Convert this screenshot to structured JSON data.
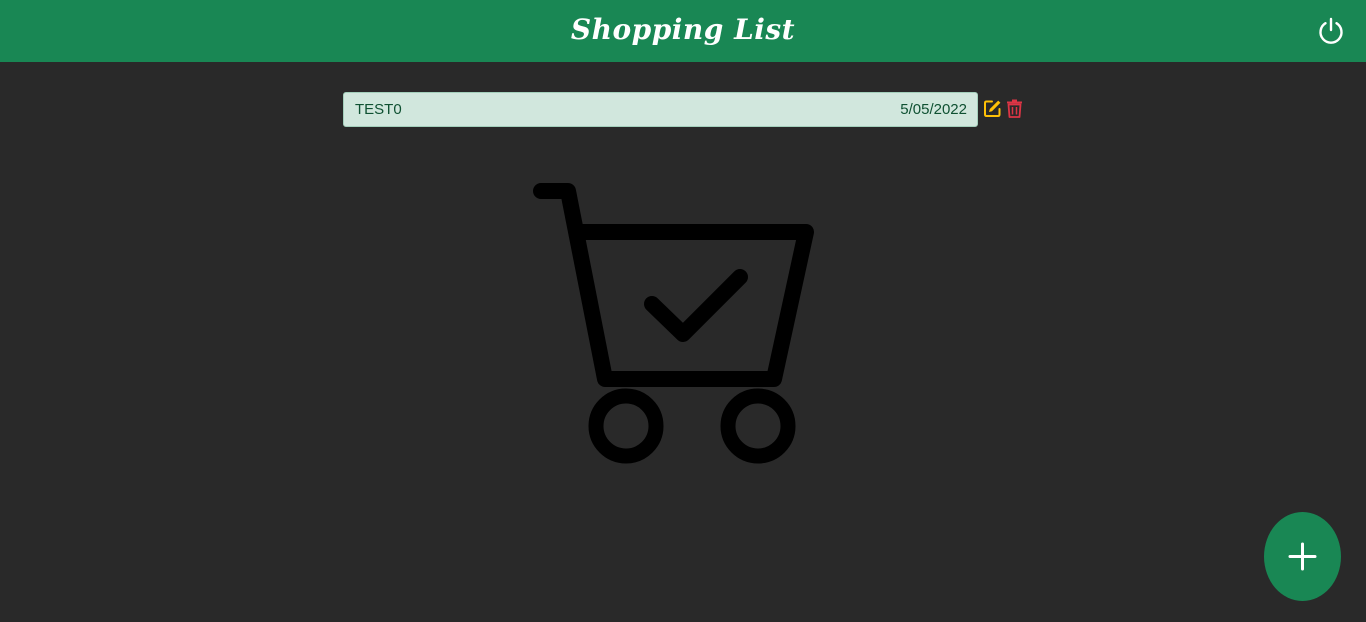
{
  "header": {
    "title": "Shopping List",
    "power_icon": "power-icon",
    "color": "#198754"
  },
  "list": {
    "items": [
      {
        "name": "TEST0",
        "date": "5/05/2022",
        "edit_icon": "edit-icon",
        "delete_icon": "trash-icon"
      }
    ]
  },
  "illustration": {
    "icon": "shopping-cart-check-icon"
  },
  "fab": {
    "icon": "plus-icon"
  },
  "colors": {
    "background": "#292929",
    "accent": "#198754",
    "item_background": "#d1e7dd",
    "item_text": "#0f5132",
    "edit": "#ffc107",
    "delete": "#dc3545"
  }
}
